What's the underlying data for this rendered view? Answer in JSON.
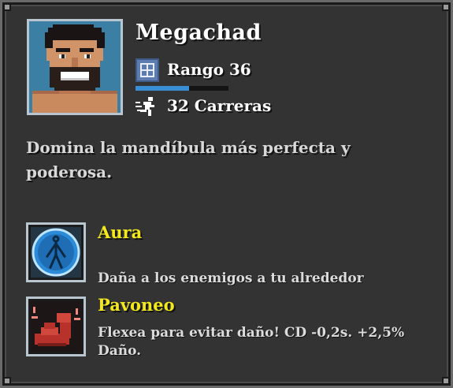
{
  "character": {
    "name": "Megachad",
    "rank_label": "Rango 36",
    "rank_progress": 0.58,
    "runs_label": "32 Carreras",
    "description": "Domina la mandíbula más perfecta y poderosa.",
    "portrait_icon": "megachad-portrait"
  },
  "abilities": [
    {
      "name": "Aura",
      "description": "Daña a los enemigos a tu alrededor",
      "icon": "aura-icon"
    },
    {
      "name": "Pavoneo",
      "description": "Flexea para evitar daño! CD -0,2s. +2,5% Daño.",
      "icon": "flex-icon"
    }
  ],
  "colors": {
    "panel_bg": "#333333",
    "ability_title": "#f2e81c",
    "rank_bar": "#3a8ed6",
    "portrait_bg": "#3b7fa4"
  }
}
